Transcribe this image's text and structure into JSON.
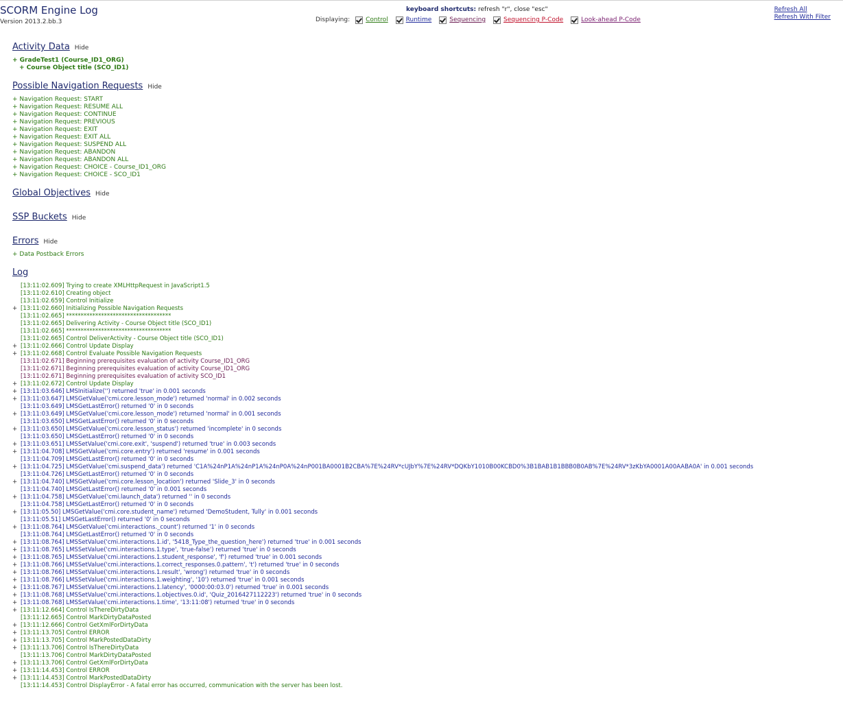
{
  "header": {
    "title": "SCORM Engine Log",
    "version": "Version 2013.2.bb.3",
    "shortcuts_label": "keyboard shortcuts:",
    "shortcuts_text": " refresh \"r\", close \"esc\"",
    "displaying_label": "Displaying:",
    "filters": [
      {
        "label": "Control",
        "checked": true,
        "color": "#2d7a14"
      },
      {
        "label": "Runtime",
        "checked": true,
        "color": "#1f2a9b"
      },
      {
        "label": "Sequencing",
        "checked": true,
        "color": "#6a1a50"
      },
      {
        "label": "Sequencing P-Code",
        "checked": true,
        "color": "#c0102a"
      },
      {
        "label": "Look-ahead P-Code",
        "checked": true,
        "color": "#7a2070"
      }
    ],
    "refresh_all": "Refresh All",
    "refresh_filter": "Refresh With Filter"
  },
  "sections": {
    "activity": "Activity Data",
    "navigation": "Possible Navigation Requests",
    "objectives": "Global Objectives",
    "ssp": "SSP Buckets",
    "errors": "Errors",
    "log": "Log",
    "hide": "Hide"
  },
  "activity_tree": [
    "+ GradeTest1 (Course_ID1_ORG)",
    "+ Course Object title (SCO_ID1)"
  ],
  "navigation_requests": [
    "+ Navigation Request: START",
    "+ Navigation Request: RESUME ALL",
    "+ Navigation Request: CONTINUE",
    "+ Navigation Request: PREVIOUS",
    "+ Navigation Request: EXIT",
    "+ Navigation Request: EXIT ALL",
    "+ Navigation Request: SUSPEND ALL",
    "+ Navigation Request: ABANDON",
    "+ Navigation Request: ABANDON ALL",
    "+ Navigation Request: CHOICE - Course_ID1_ORG",
    "+ Navigation Request: CHOICE - SCO_ID1"
  ],
  "errors_items": [
    "+ Data Postback Errors"
  ],
  "log_entries": [
    {
      "expand": "",
      "type": "control",
      "text": "[13:11:02.609] Trying to create XMLHttpRequest in JavaScript1.5"
    },
    {
      "expand": "",
      "type": "control",
      "text": "[13:11:02.610] Creating object"
    },
    {
      "expand": "",
      "type": "control",
      "text": "[13:11:02.659] Control Initialize"
    },
    {
      "expand": "+",
      "type": "control",
      "text": "[13:11:02.660] Initializing Possible Navigation Requests"
    },
    {
      "expand": "",
      "type": "control",
      "text": "[13:11:02.665] ************************************"
    },
    {
      "expand": "",
      "type": "control",
      "text": "[13:11:02.665] Delivering Activity - Course Object title (SCO_ID1)"
    },
    {
      "expand": "",
      "type": "control",
      "text": "[13:11:02.665] ************************************"
    },
    {
      "expand": "",
      "type": "control",
      "text": "[13:11:02.665] Control DeliverActivity - Course Object title (SCO_ID1)"
    },
    {
      "expand": "+",
      "type": "control",
      "text": "[13:11:02.666] Control Update Display"
    },
    {
      "expand": "+",
      "type": "control",
      "text": "[13:11:02.668] Control Evaluate Possible Navigation Requests"
    },
    {
      "expand": "",
      "type": "seq",
      "text": "[13:11:02.671] Beginning prerequisites evaluation of activity Course_ID1_ORG"
    },
    {
      "expand": "",
      "type": "seq",
      "text": "[13:11:02.671] Beginning prerequisites evaluation of activity Course_ID1_ORG"
    },
    {
      "expand": "",
      "type": "seq",
      "text": "[13:11:02.671] Beginning prerequisites evaluation of activity SCO_ID1"
    },
    {
      "expand": "+",
      "type": "control",
      "text": "[13:11:02.672] Control Update Display"
    },
    {
      "expand": "+",
      "type": "runtime",
      "text": "[13:11:03.646] LMSInitialize('') returned 'true' in 0.001 seconds"
    },
    {
      "expand": "+",
      "type": "runtime",
      "text": "[13:11:03.647] LMSGetValue('cmi.core.lesson_mode') returned 'normal' in 0.002 seconds"
    },
    {
      "expand": "",
      "type": "runtime",
      "text": "[13:11:03.649] LMSGetLastError() returned '0' in 0 seconds"
    },
    {
      "expand": "+",
      "type": "runtime",
      "text": "[13:11:03.649] LMSGetValue('cmi.core.lesson_mode') returned 'normal' in 0.001 seconds"
    },
    {
      "expand": "",
      "type": "runtime",
      "text": "[13:11:03.650] LMSGetLastError() returned '0' in 0 seconds"
    },
    {
      "expand": "+",
      "type": "runtime",
      "text": "[13:11:03.650] LMSGetValue('cmi.core.lesson_status') returned 'incomplete' in 0 seconds"
    },
    {
      "expand": "",
      "type": "runtime",
      "text": "[13:11:03.650] LMSGetLastError() returned '0' in 0 seconds"
    },
    {
      "expand": "+",
      "type": "runtime",
      "text": "[13:11:03.651] LMSSetValue('cmi.core.exit', 'suspend') returned 'true' in 0.003 seconds"
    },
    {
      "expand": "+",
      "type": "runtime",
      "text": "[13:11:04.708] LMSGetValue('cmi.core.entry') returned 'resume' in 0.001 seconds"
    },
    {
      "expand": "",
      "type": "runtime",
      "text": "[13:11:04.709] LMSGetLastError() returned '0' in 0 seconds"
    },
    {
      "expand": "+",
      "type": "runtime",
      "text": "[13:11:04.725] LMSGetValue('cmi.suspend_data') returned 'C1A%24nP1A%24nP1A%24nP0A%24nP001BA0001B2CBA%7E%24RV*cUJbY%7E%24RV*DQKbY1010B00KCBD0%3B1BAB1B1BBB0B0AB%7E%24RV*3zKbYA0001A00AABA0A' in 0.001 seconds"
    },
    {
      "expand": "",
      "type": "runtime",
      "text": "[13:11:04.726] LMSGetLastError() returned '0' in 0 seconds"
    },
    {
      "expand": "+",
      "type": "runtime",
      "text": "[13:11:04.740] LMSGetValue('cmi.core.lesson_location') returned 'Slide_3' in 0 seconds"
    },
    {
      "expand": "",
      "type": "runtime",
      "text": "[13:11:04.740] LMSGetLastError() returned '0' in 0.001 seconds"
    },
    {
      "expand": "+",
      "type": "runtime",
      "text": "[13:11:04.758] LMSGetValue('cmi.launch_data') returned '' in 0 seconds"
    },
    {
      "expand": "",
      "type": "runtime",
      "text": "[13:11:04.758] LMSGetLastError() returned '0' in 0 seconds"
    },
    {
      "expand": "+",
      "type": "runtime",
      "text": "[13:11:05.50] LMSGetValue('cmi.core.student_name') returned 'DemoStudent, Tully' in 0.001 seconds"
    },
    {
      "expand": "",
      "type": "runtime",
      "text": "[13:11:05.51] LMSGetLastError() returned '0' in 0 seconds"
    },
    {
      "expand": "+",
      "type": "runtime",
      "text": "[13:11:08.764] LMSGetValue('cmi.interactions._count') returned '1' in 0 seconds"
    },
    {
      "expand": "",
      "type": "runtime",
      "text": "[13:11:08.764] LMSGetLastError() returned '0' in 0 seconds"
    },
    {
      "expand": "+",
      "type": "runtime",
      "text": "[13:11:08.764] LMSSetValue('cmi.interactions.1.id', '5418_Type_the_question_here') returned 'true' in 0.001 seconds"
    },
    {
      "expand": "+",
      "type": "runtime",
      "text": "[13:11:08.765] LMSSetValue('cmi.interactions.1.type', 'true-false') returned 'true' in 0 seconds"
    },
    {
      "expand": "+",
      "type": "runtime",
      "text": "[13:11:08.765] LMSSetValue('cmi.interactions.1.student_response', 'f') returned 'true' in 0.001 seconds"
    },
    {
      "expand": "+",
      "type": "runtime",
      "text": "[13:11:08.766] LMSSetValue('cmi.interactions.1.correct_responses.0.pattern', 't') returned 'true' in 0 seconds"
    },
    {
      "expand": "+",
      "type": "runtime",
      "text": "[13:11:08.766] LMSSetValue('cmi.interactions.1.result', 'wrong') returned 'true' in 0 seconds"
    },
    {
      "expand": "+",
      "type": "runtime",
      "text": "[13:11:08.766] LMSSetValue('cmi.interactions.1.weighting', '10') returned 'true' in 0.001 seconds"
    },
    {
      "expand": "+",
      "type": "runtime",
      "text": "[13:11:08.767] LMSSetValue('cmi.interactions.1.latency', '0000:00:03.0') returned 'true' in 0.001 seconds"
    },
    {
      "expand": "+",
      "type": "runtime",
      "text": "[13:11:08.768] LMSSetValue('cmi.interactions.1.objectives.0.id', 'Quiz_2016427112223') returned 'true' in 0 seconds"
    },
    {
      "expand": "+",
      "type": "runtime",
      "text": "[13:11:08.768] LMSSetValue('cmi.interactions.1.time', '13:11:08') returned 'true' in 0 seconds"
    },
    {
      "expand": "+",
      "type": "control",
      "text": "[13:11:12.664] Control IsThereDirtyData"
    },
    {
      "expand": "",
      "type": "control",
      "text": "[13:11:12.665] Control MarkDirtyDataPosted"
    },
    {
      "expand": "+",
      "type": "control",
      "text": "[13:11:12.666] Control GetXmlForDirtyData"
    },
    {
      "expand": "+",
      "type": "control",
      "text": "[13:11:13.705] Control ERROR"
    },
    {
      "expand": "+",
      "type": "control",
      "text": "[13:11:13.705] Control MarkPostedDataDirty"
    },
    {
      "expand": "+",
      "type": "control",
      "text": "[13:11:13.706] Control IsThereDirtyData"
    },
    {
      "expand": "",
      "type": "control",
      "text": "[13:11:13.706] Control MarkDirtyDataPosted"
    },
    {
      "expand": "+",
      "type": "control",
      "text": "[13:11:13.706] Control GetXmlForDirtyData"
    },
    {
      "expand": "+",
      "type": "control",
      "text": "[13:11:14.453] Control ERROR"
    },
    {
      "expand": "+",
      "type": "control",
      "text": "[13:11:14.453] Control MarkPostedDataDirty"
    },
    {
      "expand": "",
      "type": "control",
      "text": "[13:11:14.453] Control DisplayError - A fatal error has occurred, communication with the server has been lost."
    }
  ]
}
